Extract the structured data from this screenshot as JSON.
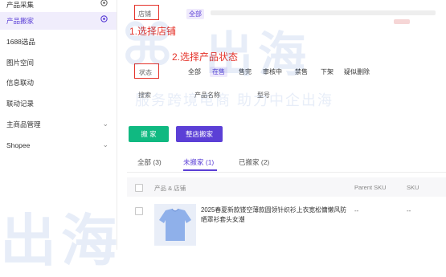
{
  "sidebar": {
    "items": [
      {
        "label": "产品采集"
      },
      {
        "label": "产品搬家"
      },
      {
        "label": "1688选品"
      },
      {
        "label": "图片空间"
      },
      {
        "label": "信息联动"
      },
      {
        "label": "联动记录"
      },
      {
        "label": "主商品管理"
      },
      {
        "label": "Shopee"
      }
    ]
  },
  "filters": {
    "store_label": "店铺",
    "store_all": "全部",
    "status_label": "状态",
    "status_options": [
      "全部",
      "在售",
      "售完",
      "审核中",
      "禁售",
      "下架",
      "疑似删除"
    ],
    "search_label": "搜索",
    "search_field": "产品名称",
    "search_field2": "型号"
  },
  "annotations": {
    "step1": "1.选择店铺",
    "step2": "2.选择产品状态"
  },
  "actions": {
    "move": "搬 家",
    "store_move": "整店搬家"
  },
  "tabs": [
    {
      "label": "全部 (3)"
    },
    {
      "label": "未搬家 (1)"
    },
    {
      "label": "已搬家 (2)"
    }
  ],
  "table": {
    "headers": [
      "产品 & 店铺",
      "Parent SKU",
      "SKU"
    ],
    "rows": [
      {
        "title": "2025春夏新款镂空薄款圆领针织衫上衣宽松慵懒风防晒罩衫套头女潮",
        "parent_sku": "--",
        "sku": "--"
      }
    ]
  },
  "watermark": {
    "brand": "出海",
    "slogan": "服务跨境电商 助力中企出海"
  },
  "colors": {
    "accent": "#5b3fd6",
    "green": "#10b981",
    "annot_red": "#e5332a"
  }
}
